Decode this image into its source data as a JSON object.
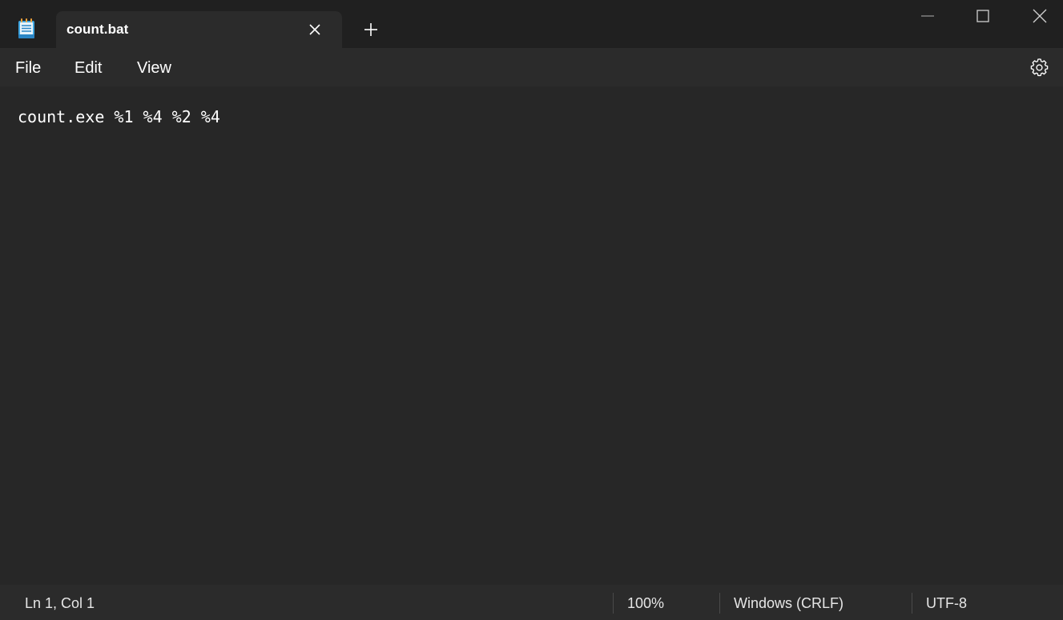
{
  "window": {
    "tab_title": "count.bat"
  },
  "menu": {
    "file": "File",
    "edit": "Edit",
    "view": "View"
  },
  "editor": {
    "content": "count.exe %1 %4 %2 %4"
  },
  "status": {
    "position": "Ln 1, Col 1",
    "zoom": "100%",
    "line_ending": "Windows (CRLF)",
    "encoding": "UTF-8"
  },
  "icons": {
    "app": "notepad-icon",
    "tab_close": "close-icon",
    "new_tab": "plus-icon",
    "minimize": "minimize-icon",
    "maximize": "maximize-icon",
    "close": "close-icon",
    "settings": "gear-icon"
  },
  "colors": {
    "titlebar_bg": "#202020",
    "tab_bg": "#2b2b2b",
    "editor_bg": "#272727",
    "text": "#ffffff"
  }
}
